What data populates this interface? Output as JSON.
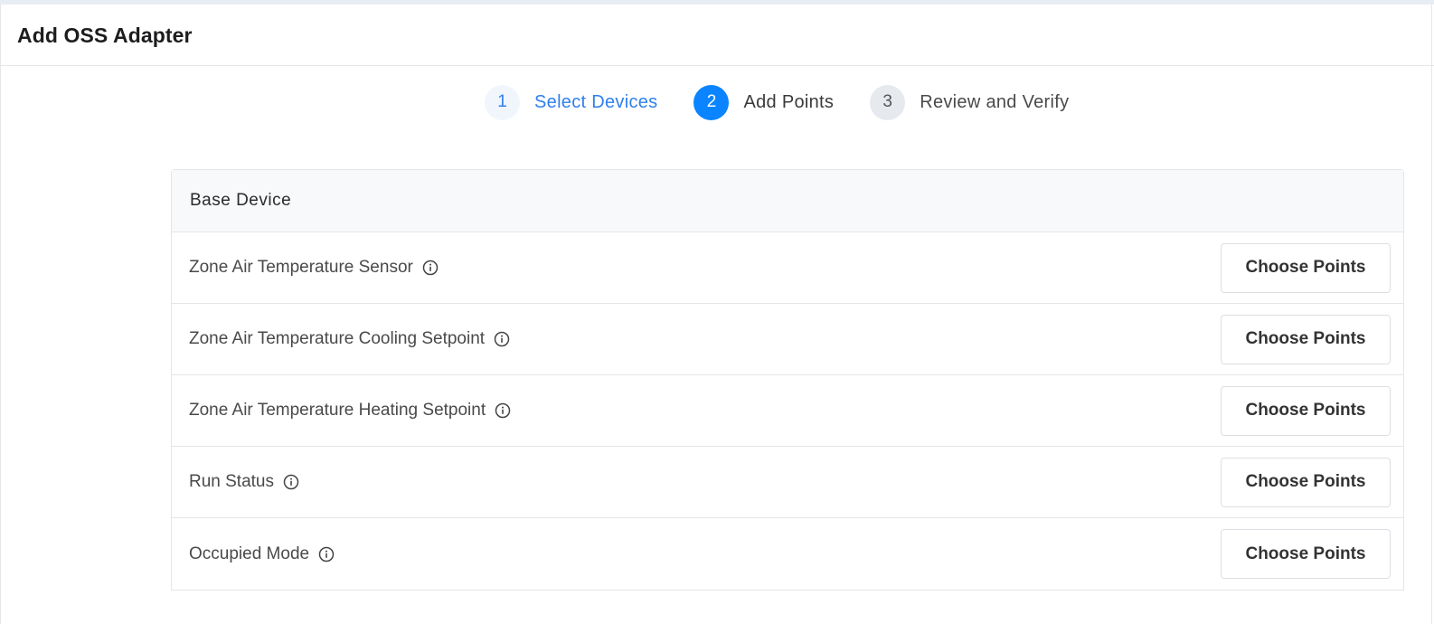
{
  "header": {
    "title": "Add OSS Adapter"
  },
  "stepper": {
    "steps": [
      {
        "number": "1",
        "label": "Select Devices",
        "state": "completed"
      },
      {
        "number": "2",
        "label": "Add Points",
        "state": "active"
      },
      {
        "number": "3",
        "label": "Review and Verify",
        "state": "pending"
      }
    ]
  },
  "panel": {
    "title": "Base Device",
    "rows": [
      {
        "label": "Zone Air Temperature Sensor",
        "button": "Choose Points"
      },
      {
        "label": "Zone Air Temperature Cooling Setpoint",
        "button": "Choose Points"
      },
      {
        "label": "Zone Air Temperature Heating Setpoint",
        "button": "Choose Points"
      },
      {
        "label": "Run Status",
        "button": "Choose Points"
      },
      {
        "label": "Occupied Mode",
        "button": "Choose Points"
      }
    ]
  },
  "colors": {
    "accent": "#0a84ff",
    "completed": "#2f80ed",
    "pending_bg": "#e6e9ee"
  },
  "icons": {
    "row_info": "info-circle-icon"
  }
}
